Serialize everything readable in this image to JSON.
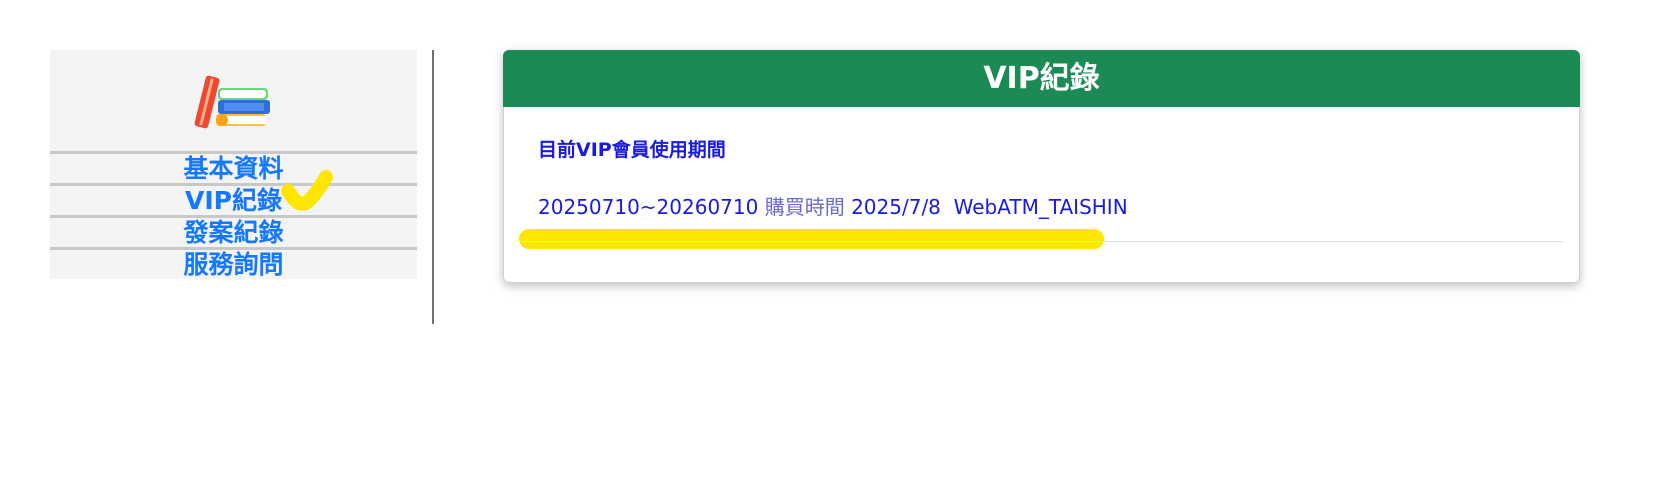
{
  "sidebar": {
    "items": [
      {
        "label": "基本資料"
      },
      {
        "label": "VIP紀錄"
      },
      {
        "label": "發案紀錄"
      },
      {
        "label": "服務詢問"
      }
    ]
  },
  "panel": {
    "title": "VIP紀錄",
    "period_label": "目前VIP會員使用期間",
    "record": {
      "period": "20250710~20260710",
      "purchase_label": "購買時間",
      "purchase_date": "2025/7/8",
      "payment_method": "WebATM_TAISHIN"
    }
  },
  "colors": {
    "header_bg": "#1b8a54",
    "nav_text": "#1677ff",
    "body_text": "#1a1ae0",
    "highlight": "#ffe600"
  },
  "icons": {
    "logo": "books-icon",
    "annotation": "checkmark-icon"
  }
}
